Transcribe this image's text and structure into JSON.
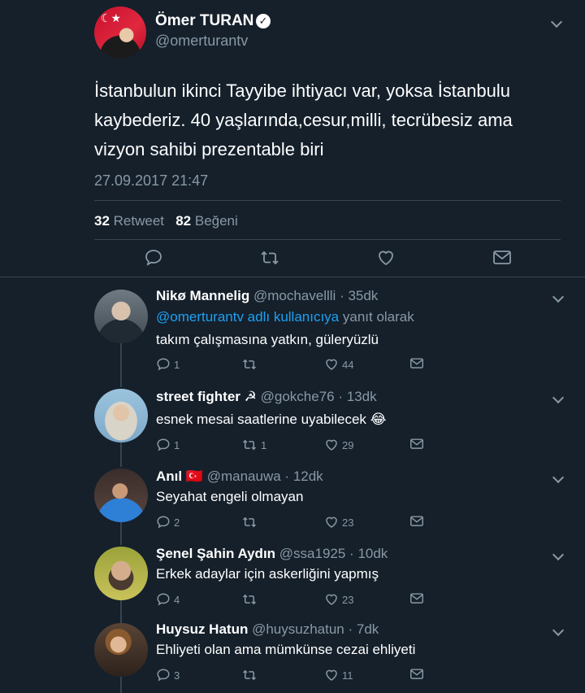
{
  "main_tweet": {
    "author_name": "Ömer TURAN",
    "handle": "@omerturantv",
    "text": "İstanbulun ikinci Tayyibe ihtiyacı var, yoksa İstanbulu kaybederiz. 40 yaşlarında,cesur,milli, tecrübesiz ama vizyon sahibi prezentable biri",
    "timestamp": "27.09.2017 21:47",
    "retweet_count": "32",
    "retweet_label": "Retweet",
    "like_count": "82",
    "like_label": "Beğeni"
  },
  "icons": {
    "reply": "reply-icon",
    "retweet": "retweet-icon",
    "like": "heart-icon",
    "message": "mail-icon",
    "more": "chevron-down-icon",
    "verified": "verified-badge-icon"
  },
  "colors": {
    "background": "#15202b",
    "text_primary": "#ffffff",
    "text_secondary": "#8899a6",
    "link": "#1da1f2",
    "divider": "#38444d"
  },
  "replies": [
    {
      "name": "Nikø Mannelig",
      "handle": "@mochavellli",
      "time": "35dk",
      "in_reply_to_link": "@omerturantv adlı kullanıcıya",
      "in_reply_to_rest": "yanıt olarak",
      "text": "takım çalışmasına yatkın, güleryüzlü",
      "reply_count": "1",
      "retweet_count": "",
      "like_count": "44"
    },
    {
      "name": "street fighter ☭",
      "handle": "@gokche76",
      "time": "13dk",
      "text": "esnek mesai saatlerine uyabilecek 😂",
      "reply_count": "1",
      "retweet_count": "1",
      "like_count": "29"
    },
    {
      "name": "Anıl 🇹🇷",
      "handle": "@manauwa",
      "time": "12dk",
      "text": "Seyahat engeli olmayan",
      "reply_count": "2",
      "retweet_count": "",
      "like_count": "23"
    },
    {
      "name": "Şenel Şahin Aydın",
      "handle": "@ssa1925",
      "time": "10dk",
      "text": "Erkek adaylar için askerliğini yapmış",
      "reply_count": "4",
      "retweet_count": "",
      "like_count": "23"
    },
    {
      "name": "Huysuz Hatun",
      "handle": "@huysuzhatun",
      "time": "7dk",
      "text": "Ehliyeti olan ama mümkünse cezai ehliyeti",
      "reply_count": "3",
      "retweet_count": "",
      "like_count": "11"
    }
  ]
}
